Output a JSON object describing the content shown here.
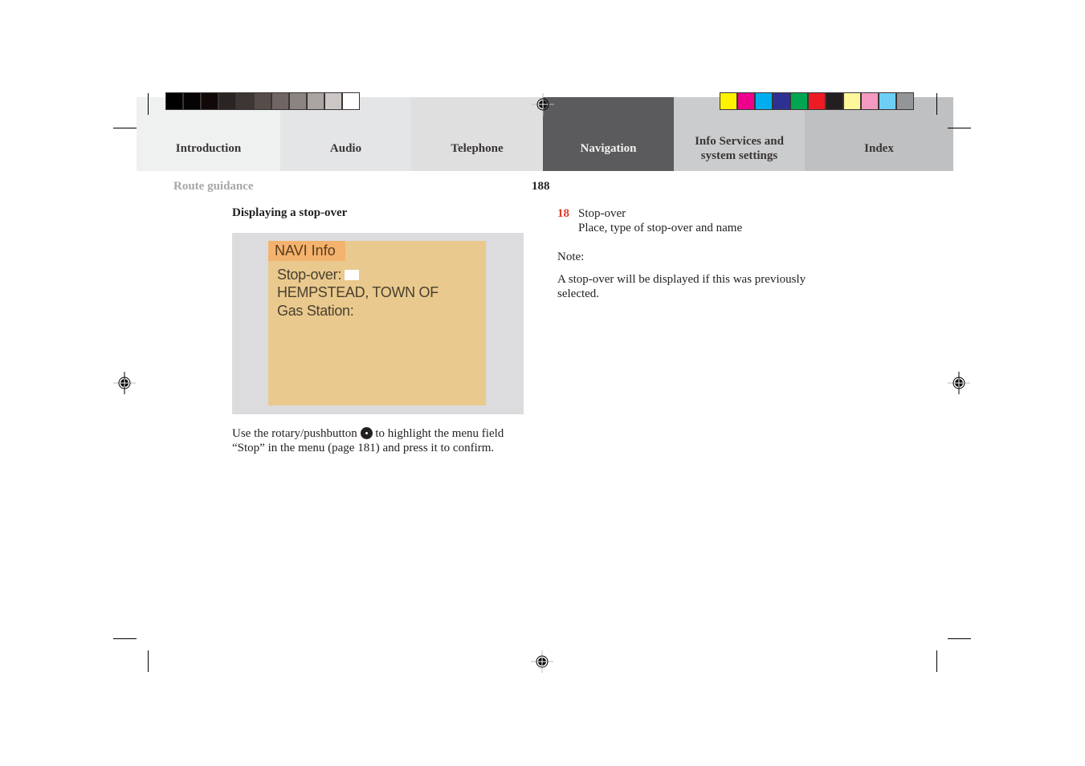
{
  "tabs": [
    {
      "label": "Introduction",
      "bg": "#eff0f0",
      "active": false
    },
    {
      "label": "Audio",
      "bg": "#e4e5e7",
      "active": false
    },
    {
      "label": "Telephone",
      "bg": "#dfdfdf",
      "active": false
    },
    {
      "label": "Navigation",
      "bg": "#5b5b5d",
      "active": true
    },
    {
      "label": "Info Services and system settings",
      "bg": "#cbcccd",
      "active": false
    },
    {
      "label": "Index",
      "bg": "#bfc0c1",
      "active": false
    }
  ],
  "grayscale_bar": [
    "#000000",
    "#050303",
    "#120808",
    "#2a2422",
    "#3d3634",
    "#564d4b",
    "#6f6664",
    "#8c8482",
    "#aaa4a2",
    "#cbc7c5",
    "#ffffff"
  ],
  "color_bar": [
    "#fff200",
    "#ec008c",
    "#00aeef",
    "#2e3192",
    "#00a651",
    "#ed1c24",
    "#231f20",
    "#fff799",
    "#f49ac1",
    "#6dcff6",
    "#939598"
  ],
  "header": {
    "section": "Route guidance",
    "page_number": "188"
  },
  "left_column": {
    "heading": "Displaying a stop-over",
    "screen": {
      "title": "NAVI Info",
      "lines": [
        "Stop-over:",
        "HEMPSTEAD, TOWN OF",
        "Gas Station:"
      ]
    },
    "instruction_before_icon": "Use the rotary/pushbutton",
    "instruction_icon": "rotary-pushbutton-icon",
    "instruction_after_icon": " to highlight the menu field “Stop” in the menu (page 181) and press it to confirm."
  },
  "right_column": {
    "legend": [
      {
        "number": "18",
        "title": "Stop-over",
        "description": "Place, type of stop-over and name"
      }
    ],
    "note_label": "Note:",
    "note_text": "A stop-over will be displayed if this was previously selected."
  },
  "colors": {
    "accent_number": "#e03a2a",
    "active_tab": "#5b5b5d",
    "screen_bg": "#e9c98e",
    "screen_title_bg": "#f3b36e"
  }
}
